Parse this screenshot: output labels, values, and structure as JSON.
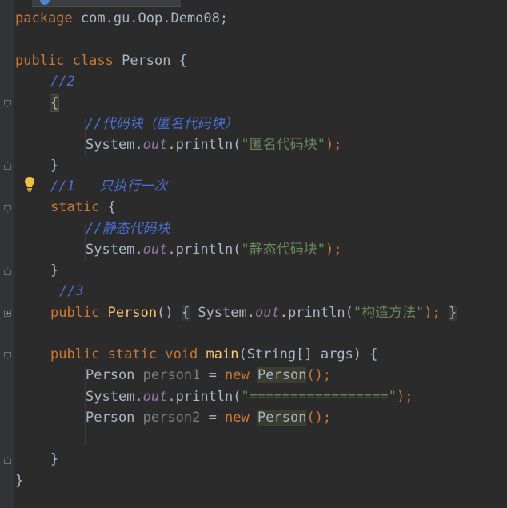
{
  "editor": {
    "tab": {
      "title": ""
    },
    "lines": {
      "l1": {
        "kw": "package",
        "text": " com.gu.Oop.Demo08;"
      },
      "l3": {
        "kw1": "public",
        "kw2": "class",
        "name": " Person {"
      },
      "l4": {
        "comment": "//2"
      },
      "l5": {
        "brace": "{"
      },
      "l6": {
        "comment": "//代码块（匿名代码块）"
      },
      "l7": {
        "system": "System.",
        "out": "out",
        "call": ".println(",
        "str": "\"匿名代码块\"",
        "end": ");"
      },
      "l8": {
        "brace": "}"
      },
      "l9": {
        "comment": "//1   只执行一次"
      },
      "l10": {
        "kw": "static",
        "text": " {"
      },
      "l11": {
        "comment": "//静态代码块"
      },
      "l12": {
        "system": "System.",
        "out": "out",
        "call": ".println(",
        "str": "\"静态代码块\"",
        "end": ");"
      },
      "l13": {
        "brace": "}"
      },
      "l14": {
        "comment": "//3"
      },
      "l15": {
        "kw": "public",
        "ctor": "Person",
        "parens": "()",
        "open": "{",
        "system": "System.",
        "out": "out",
        "call": ".println(",
        "str": "\"构造方法\"",
        "end": ");",
        "close": "}"
      },
      "l17": {
        "kw1": "public",
        "kw2": "static",
        "kw3": "void",
        "fn": "main",
        "params": "(String[] args) {"
      },
      "l18": {
        "type": "Person",
        "var": "person1",
        "eq": " = ",
        "kw": "new",
        "ctor": "Person",
        "end": "();"
      },
      "l19": {
        "system": "System.",
        "out": "out",
        "call": ".println(",
        "str": "\"=================\"",
        "end": ");"
      },
      "l20": {
        "type": "Person",
        "var": "person2",
        "eq": " = ",
        "kw": "new",
        "ctor": "Person",
        "end": "();"
      },
      "l22": {
        "brace": "}"
      },
      "l23": {
        "brace": "}"
      }
    }
  },
  "colors": {
    "background": "#2b2b2b",
    "keyword": "#cc7832",
    "string": "#6a8759",
    "static_field": "#9876aa",
    "method": "#ffc66d",
    "comment_blue": "#4b6fd6",
    "text": "#a9b7c6",
    "unused": "#808080"
  },
  "icons": {
    "gutter_fold": "fold-marker-icon",
    "intention": "lightbulb-icon"
  }
}
